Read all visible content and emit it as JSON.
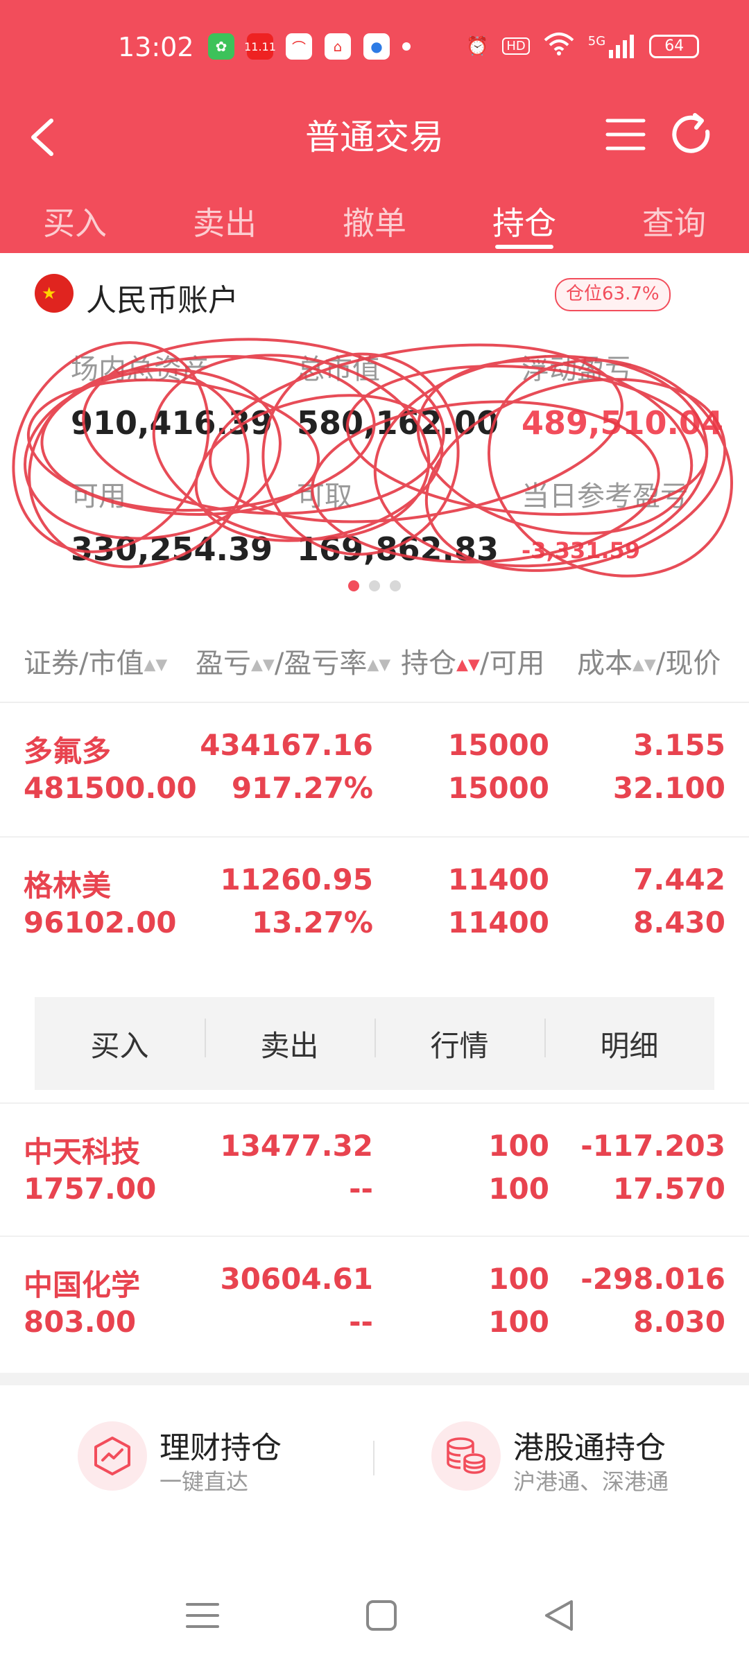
{
  "status_bar": {
    "time": "13:02",
    "battery": "64",
    "hd": "HD",
    "network": "5G",
    "notif_badge": "11.11"
  },
  "header": {
    "title": "普通交易",
    "tabs": [
      {
        "label": "买入",
        "active": false
      },
      {
        "label": "卖出",
        "active": false
      },
      {
        "label": "撤单",
        "active": false
      },
      {
        "label": "持仓",
        "active": true
      },
      {
        "label": "查询",
        "active": false
      }
    ]
  },
  "account": {
    "flag_icon": "china-flag-icon",
    "title": "人民币账户",
    "position_badge": "仓位63.7%",
    "metrics": {
      "total_assets_label": "场内总资产",
      "total_assets_value": "910,416.39",
      "market_value_label": "总市值",
      "market_value_value": "580,162.00",
      "floating_pl_label": "浮动盈亏",
      "floating_pl_value": "489,510.04",
      "available_label": "可用",
      "available_value": "330,254.39",
      "withdrawable_label": "可取",
      "withdrawable_value": "169,862.83",
      "daily_pl_label": "当日参考盈亏",
      "daily_pl_value": "-3,331.59"
    },
    "pager_count": 3,
    "pager_active": 0
  },
  "columns": {
    "c1": "证券/市值",
    "c2": "盈亏",
    "c2b": "/盈亏率",
    "c3": "持仓",
    "c3b": "/可用",
    "c4": "成本",
    "c4b": "/现价"
  },
  "holdings": [
    {
      "name": "多氟多",
      "market_value": "481500.00",
      "pl": "434167.16",
      "pl_rate": "917.27%",
      "position": "15000",
      "available": "15000",
      "cost": "3.155",
      "price": "32.100"
    },
    {
      "name": "格林美",
      "market_value": "96102.00",
      "pl": "11260.95",
      "pl_rate": "13.27%",
      "position": "11400",
      "available": "11400",
      "cost": "7.442",
      "price": "8.430"
    },
    {
      "name": "中天科技",
      "market_value": "1757.00",
      "pl": "13477.32",
      "pl_rate": "--",
      "position": "100",
      "available": "100",
      "cost": "-117.203",
      "price": "17.570"
    },
    {
      "name": "中国化学",
      "market_value": "803.00",
      "pl": "30604.61",
      "pl_rate": "--",
      "position": "100",
      "available": "100",
      "cost": "-298.016",
      "price": "8.030"
    }
  ],
  "row_actions": [
    "买入",
    "卖出",
    "行情",
    "明细"
  ],
  "links": [
    {
      "title": "理财持仓",
      "subtitle": "一键直达",
      "icon": "wealth-chart-icon"
    },
    {
      "title": "港股通持仓",
      "subtitle": "沪港通、深港通",
      "icon": "coins-stack-icon"
    }
  ],
  "colors": {
    "brand_red": "#f24d5b",
    "value_red": "#e8434f",
    "scribble_red": "#e53945"
  }
}
